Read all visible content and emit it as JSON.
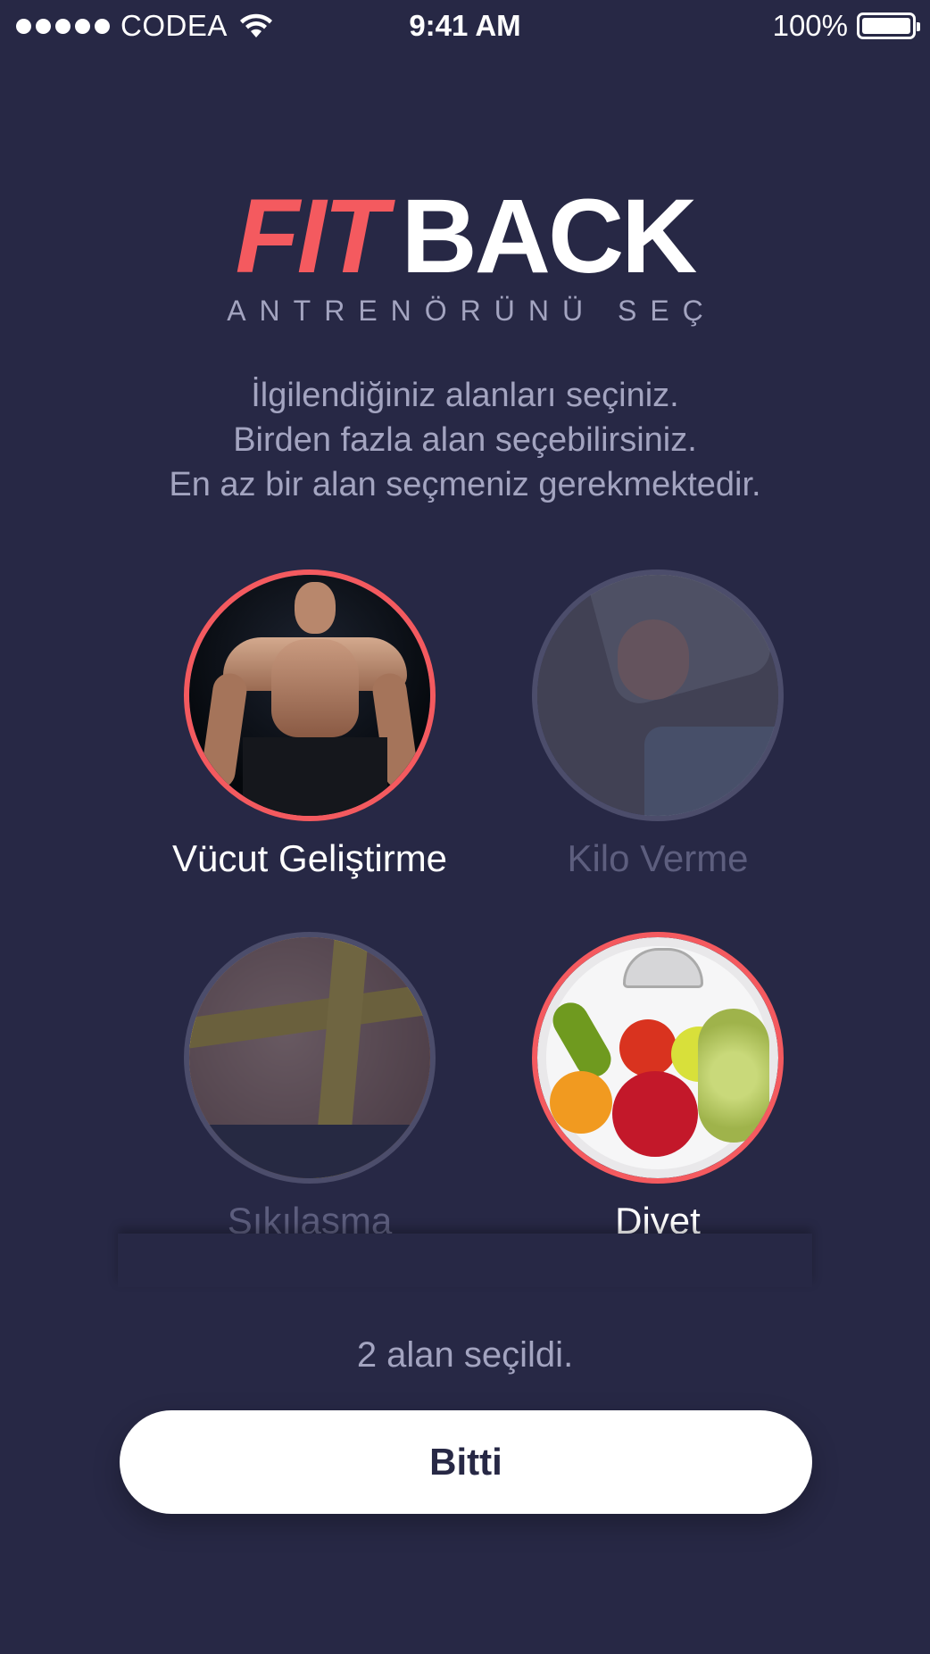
{
  "status_bar": {
    "carrier": "CODEA",
    "time": "9:41 AM",
    "battery": "100%"
  },
  "logo": {
    "fit": "FIT",
    "back": "BACK",
    "tagline": "ANTRENÖRÜNÜ SEÇ"
  },
  "instructions": {
    "line1": "İlgilendiğiniz alanları seçiniz.",
    "line2": "Birden fazla alan seçebilirsiniz.",
    "line3": "En az bir alan seçmeniz gerekmektedir."
  },
  "categories": [
    {
      "label": "Vücut Geliştirme",
      "selected": true
    },
    {
      "label": "Kilo Verme",
      "selected": false
    },
    {
      "label": "Sıkılaşma",
      "selected": false
    },
    {
      "label": "Diyet",
      "selected": true
    }
  ],
  "footer": {
    "count_text": "2 alan seçildi.",
    "done_label": "Bitti"
  },
  "colors": {
    "background": "#272845",
    "accent": "#f45a5f",
    "muted_text": "#a3a4c0"
  }
}
